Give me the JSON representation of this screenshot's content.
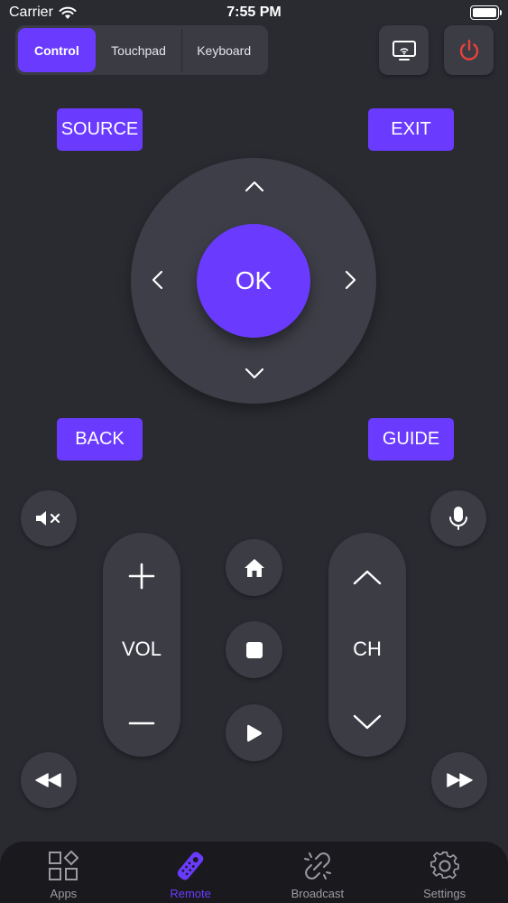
{
  "status_bar": {
    "carrier": "Carrier",
    "time": "7:55 PM"
  },
  "segment": {
    "tabs": [
      "Control",
      "Touchpad",
      "Keyboard"
    ],
    "active": "Control"
  },
  "buttons": {
    "source": "SOURCE",
    "exit": "EXIT",
    "ok": "OK",
    "back": "BACK",
    "guide": "GUIDE",
    "volume": "VOL",
    "channel": "CH"
  },
  "tab_bar": {
    "items": [
      "Apps",
      "Remote",
      "Broadcast",
      "Settings"
    ],
    "active": "Remote"
  },
  "colors": {
    "accent": "#6a3bff",
    "power": "#e8413b",
    "background": "#2a2b31"
  },
  "icons": {
    "cast": "cast-screen-icon",
    "power": "power-icon",
    "mute": "mute-icon",
    "mic": "microphone-icon",
    "home": "home-icon",
    "stop": "stop-icon",
    "play": "play-icon",
    "rewind": "rewind-icon",
    "fast_forward": "fast-forward-icon"
  }
}
